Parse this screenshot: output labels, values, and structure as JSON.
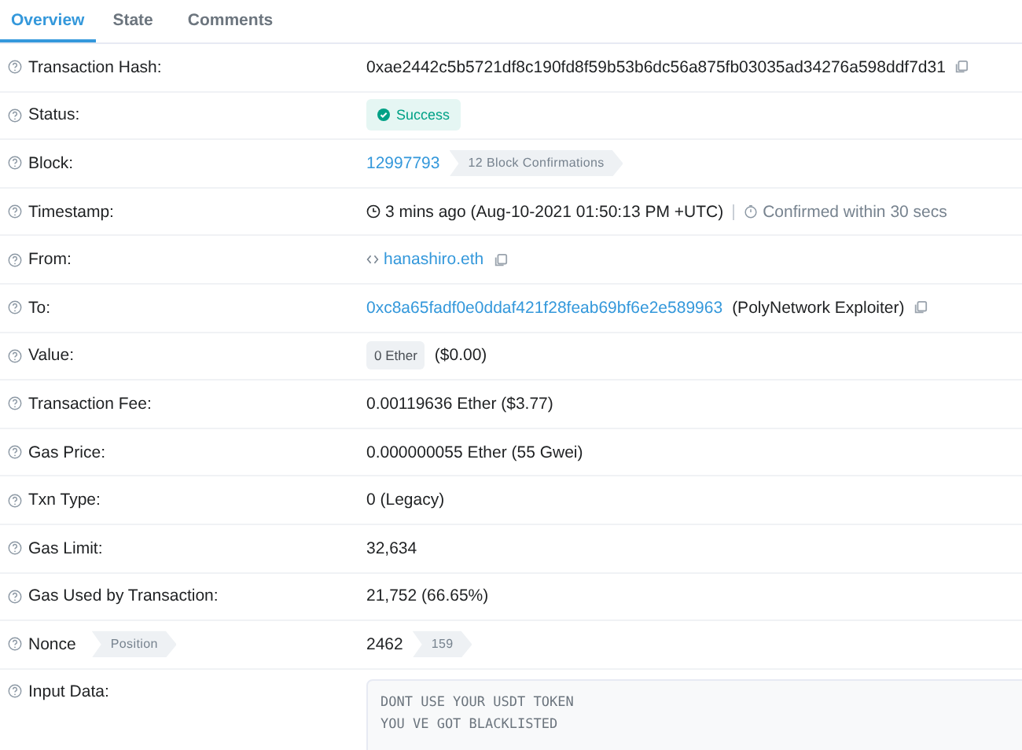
{
  "tabs": [
    {
      "label": "Overview",
      "selected": true
    },
    {
      "label": "State",
      "selected": false
    },
    {
      "label": "Comments",
      "selected": false
    }
  ],
  "rows": [
    {
      "label": "Transaction Hash:",
      "parts": [
        {
          "kind": "text",
          "text": "0xae2442c5b5721df8c190fd8f59b53b6dc56a875fb03035ad34276a598ddf7d31"
        },
        {
          "kind": "copy"
        }
      ]
    },
    {
      "label": "Status:",
      "parts": [
        {
          "kind": "status",
          "text": "Success"
        }
      ]
    },
    {
      "label": "Block:",
      "parts": [
        {
          "kind": "link",
          "text": "12997793"
        },
        {
          "kind": "tag",
          "text": "12 Block Confirmations"
        }
      ]
    },
    {
      "label": "Timestamp:",
      "parts": [
        {
          "kind": "time",
          "text": "3 mins ago (Aug-10-2021 01:50:13 PM +UTC)"
        },
        {
          "kind": "divider"
        },
        {
          "kind": "timer",
          "text": "Confirmed within 30 secs"
        }
      ]
    },
    {
      "label": "From:",
      "parts": [
        {
          "kind": "contract",
          "text": "hanashiro.eth"
        },
        {
          "kind": "copy"
        }
      ]
    },
    {
      "label": "To:",
      "parts": [
        {
          "kind": "link",
          "text": "0xc8a65fadf0e0ddaf421f28feab69bf6e2e589963"
        },
        {
          "kind": "text",
          "text": "(PolyNetwork Exploiter)"
        },
        {
          "kind": "copy"
        }
      ]
    },
    {
      "label": "Value:",
      "parts": [
        {
          "kind": "chip",
          "text": "0 Ether"
        },
        {
          "kind": "text",
          "text": "($0.00)"
        }
      ]
    },
    {
      "label": "Transaction Fee:",
      "parts": [
        {
          "kind": "text",
          "text": "0.00119636 Ether ($3.77)"
        }
      ]
    },
    {
      "label": "Gas Price:",
      "parts": [
        {
          "kind": "text",
          "text": "0.000000055 Ether (55 Gwei)"
        }
      ]
    },
    {
      "label": "Txn Type:",
      "parts": [
        {
          "kind": "text",
          "text": "0 (Legacy)"
        }
      ]
    },
    {
      "label": "Gas Limit:",
      "parts": [
        {
          "kind": "text",
          "text": "32,634"
        }
      ]
    },
    {
      "label": "Gas Used by Transaction:",
      "parts": [
        {
          "kind": "text",
          "text": "21,752 (66.65%)"
        }
      ]
    },
    {
      "label": "Nonce",
      "label_tag": "Position",
      "parts": [
        {
          "kind": "text",
          "text": "2462"
        },
        {
          "kind": "tag",
          "text": "159"
        }
      ]
    },
    {
      "label": "Input Data:",
      "parts": [
        {
          "kind": "code",
          "lines": [
            "DONT USE YOUR USDT TOKEN",
            "YOU VE GOT BLACKLISTED"
          ]
        }
      ]
    }
  ]
}
